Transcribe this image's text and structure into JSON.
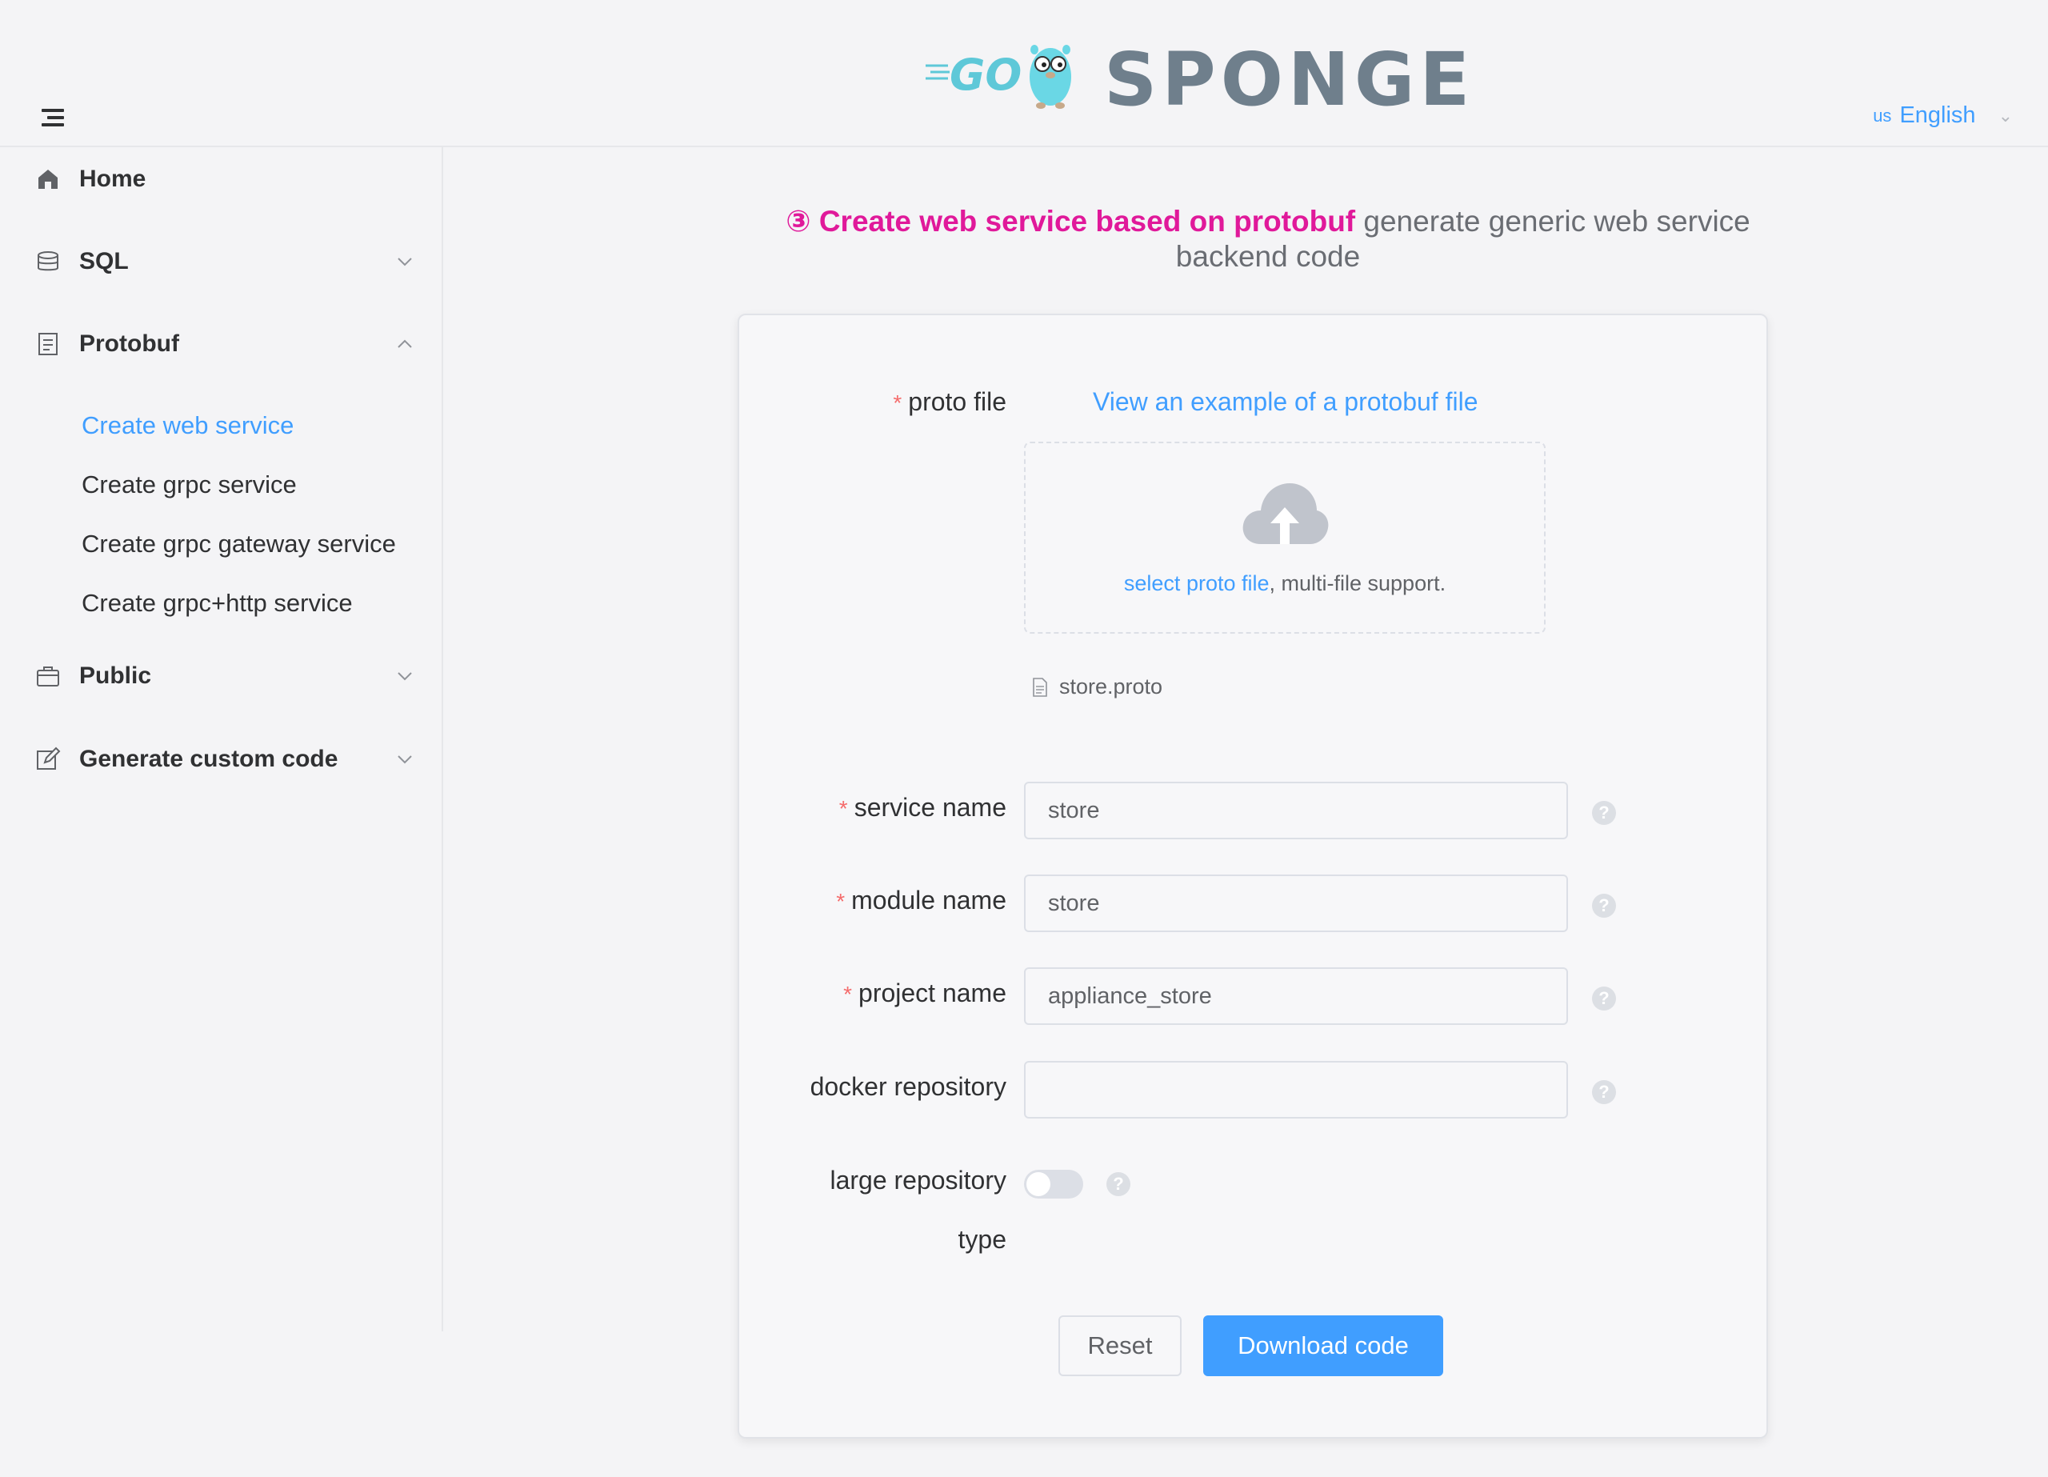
{
  "header": {
    "logo_text": "SPONGE",
    "logo_go": "GO",
    "language": {
      "flag": "us",
      "label": "English"
    }
  },
  "sidebar": {
    "items": [
      {
        "label": "Home",
        "icon": "home-icon"
      },
      {
        "label": "SQL",
        "icon": "database-icon",
        "expanded": false
      },
      {
        "label": "Protobuf",
        "icon": "document-icon",
        "expanded": true,
        "children": [
          {
            "label": "Create web service",
            "active": true
          },
          {
            "label": "Create grpc service"
          },
          {
            "label": "Create grpc gateway service"
          },
          {
            "label": "Create grpc+http service"
          }
        ]
      },
      {
        "label": "Public",
        "icon": "briefcase-icon",
        "expanded": false
      },
      {
        "label": "Generate custom code",
        "icon": "edit-icon",
        "expanded": false
      }
    ]
  },
  "main": {
    "title_highlight": "③ Create web service based on protobuf",
    "title_rest": " generate generic web service backend code",
    "form": {
      "proto_file_label": "proto file",
      "example_link": "View an example of a protobuf file",
      "upload_select": "select proto file",
      "upload_rest": ", multi-file support.",
      "uploaded_file": "store.proto",
      "service_name": {
        "label": "service name",
        "value": "store"
      },
      "module_name": {
        "label": "module name",
        "value": "store"
      },
      "project_name": {
        "label": "project name",
        "value": "appliance_store"
      },
      "docker_repository": {
        "label": "docker repository",
        "value": ""
      },
      "large_repository_type": {
        "label_line1": "large repository",
        "label_line2": "type",
        "enabled": false
      },
      "help_glyph": "?",
      "required_mark": "*"
    },
    "buttons": {
      "reset": "Reset",
      "download": "Download code"
    }
  }
}
